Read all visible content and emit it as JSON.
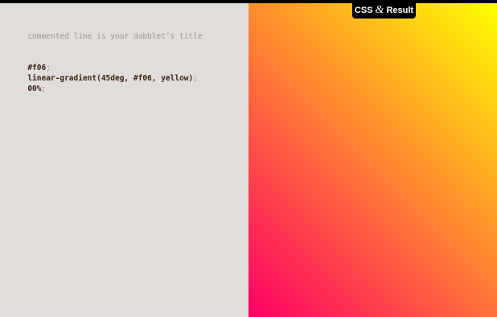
{
  "editor": {
    "comment": "commented line is your dabblet’s title",
    "lines": [
      {
        "value": "#f06",
        "punct": ";"
      },
      {
        "value": "linear-gradient(45deg, #f06, yellow)",
        "punct": ";"
      },
      {
        "value": "00%",
        "punct": ";"
      }
    ]
  },
  "mode_switch": {
    "left": "CSS",
    "amp": "&",
    "right": "Result"
  },
  "colors": {
    "editor_bg": "#e0ddda",
    "gradient_start": "#f06",
    "gradient_end": "yellow",
    "comment": "#9a9a9a",
    "code_value": "#3a1f16"
  }
}
